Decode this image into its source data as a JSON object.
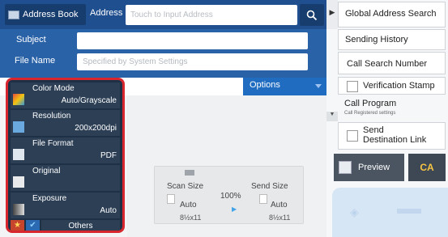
{
  "top": {
    "address_book": "Address Book",
    "address_label": "Address",
    "address_placeholder": "Touch to Input Address"
  },
  "form": {
    "subject_label": "Subject",
    "file_name_label": "File Name",
    "file_name_value": "Specified by System Settings"
  },
  "options_tab": "Options",
  "left_options": [
    {
      "title": "Color Mode",
      "value": "Auto/Grayscale",
      "icon": "color-mode-icon"
    },
    {
      "title": "Resolution",
      "value": "200x200dpi",
      "icon": "resolution-icon"
    },
    {
      "title": "File Format",
      "value": "PDF",
      "icon": "file-format-icon"
    },
    {
      "title": "Original",
      "value": "",
      "icon": "original-icon"
    },
    {
      "title": "Exposure",
      "value": "Auto",
      "icon": "exposure-icon"
    }
  ],
  "others_label": "Others",
  "preview": {
    "scan_size_label": "Scan Size",
    "send_size_label": "Send Size",
    "ratio": "100%",
    "scan_auto": "Auto",
    "send_auto": "Auto",
    "scan_size": "8½x11",
    "send_size": "8½x11"
  },
  "right": {
    "global_address_search": "Global Address Search",
    "sending_history": "Sending History",
    "call_search_number": "Call Search Number",
    "verification_stamp": "Verification Stamp",
    "call_program": "Call Program",
    "call_program_sub": "Call Registered settings",
    "send_destination_link": "Send\nDestination Link",
    "preview": "Preview",
    "ca": "CA"
  },
  "colors": {
    "header_blue": "#1f4f8f",
    "panel_dark": "#1d3046",
    "highlight_red": "#d8262f",
    "options_blue": "#1f6cc0",
    "ca_yellow": "#f6c543"
  }
}
